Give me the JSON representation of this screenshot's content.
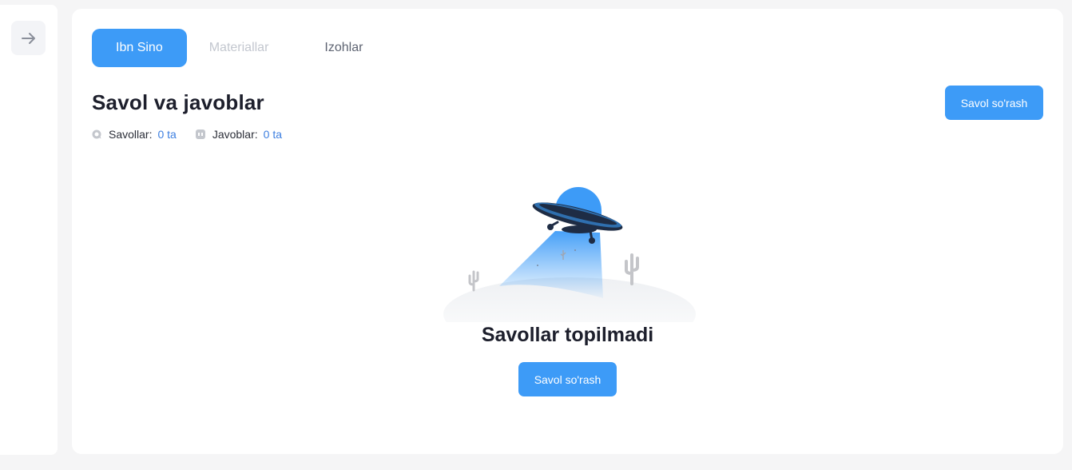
{
  "sidebar": {
    "toggle_icon": "arrow-right-icon"
  },
  "tabs": [
    {
      "label": "Ibn Sino",
      "active": true
    },
    {
      "label": "Materiallar",
      "active": false
    },
    {
      "label": "Izohlar",
      "active": false
    }
  ],
  "header": {
    "title": "Savol va javoblar",
    "ask_button_label": "Savol so'rash"
  },
  "stats": {
    "questions_label": "Savollar:",
    "questions_value": "0 ta",
    "questions_icon": "chat-icon",
    "answers_label": "Javoblar:",
    "answers_value": "0 ta",
    "answers_icon": "quote-icon"
  },
  "empty_state": {
    "illustration": "ufo-desert-illustration",
    "title": "Savollar topilmadi",
    "button_label": "Savol so'rash"
  },
  "colors": {
    "accent": "#3d9bf7",
    "value_link": "#3d7fe0",
    "page_bg": "#f5f5f6"
  }
}
